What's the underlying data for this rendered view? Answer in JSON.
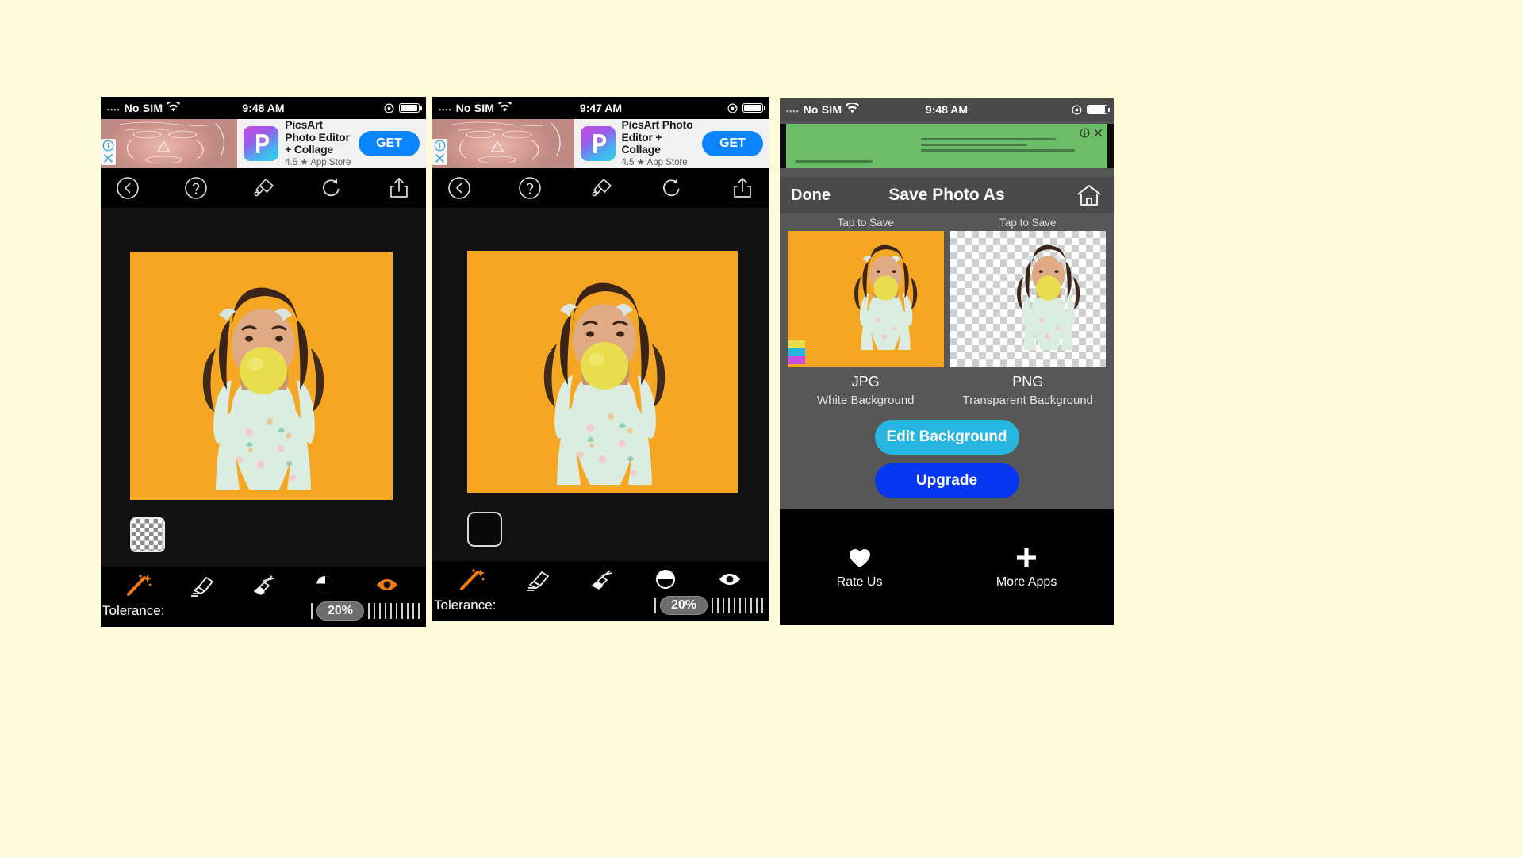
{
  "page": {
    "background_color": "#fdfbda"
  },
  "phones": [
    {
      "id": "phone-left",
      "status": {
        "dots": "••••",
        "carrier": "No SIM",
        "wifi_icon": "wifi-icon",
        "time": "9:48 AM",
        "lock_icon": "rotation-lock-icon",
        "battery_icon": "battery-icon"
      },
      "ad": {
        "info_icon": "ad-info-icon",
        "close_icon": "ad-close-icon",
        "app_icon": "picsart-app-icon",
        "title": "PicsArt Photo Editor + Collage",
        "subtitle": "4.5 ★ App Store",
        "cta": "GET"
      },
      "toolbar": [
        {
          "name": "back-button",
          "icon": "chevron-left-circle-icon"
        },
        {
          "name": "help-button",
          "icon": "question-circle-icon"
        },
        {
          "name": "brush-button",
          "icon": "paint-brush-icon"
        },
        {
          "name": "undo-button",
          "icon": "undo-arrow-icon"
        },
        {
          "name": "share-button",
          "icon": "share-upload-icon"
        }
      ],
      "swatch": {
        "name": "transparent-background-swatch",
        "type": "checkerboard"
      },
      "tools": [
        {
          "name": "magic-wand-tool",
          "icon": "magic-wand-icon",
          "active": true
        },
        {
          "name": "eraser-tool",
          "icon": "eraser-icon",
          "active": false
        },
        {
          "name": "restore-tool",
          "icon": "restore-brush-icon",
          "active": false
        },
        {
          "name": "contrast-tool",
          "icon": "contrast-circle-icon",
          "active": false
        },
        {
          "name": "preview-tool",
          "icon": "eye-icon",
          "active": true
        }
      ],
      "tolerance": {
        "label": "Tolerance:",
        "value": "20%"
      }
    },
    {
      "id": "phone-middle",
      "status": {
        "dots": "••••",
        "carrier": "No SIM",
        "wifi_icon": "wifi-icon",
        "time": "9:47 AM",
        "lock_icon": "rotation-lock-icon",
        "battery_icon": "battery-icon"
      },
      "ad": {
        "info_icon": "ad-info-icon",
        "close_icon": "ad-close-icon",
        "app_icon": "picsart-app-icon",
        "title": "PicsArt Photo Editor + Collage",
        "subtitle": "4.5 ★ App Store",
        "cta": "GET"
      },
      "toolbar": [
        {
          "name": "back-button",
          "icon": "chevron-left-circle-icon"
        },
        {
          "name": "help-button",
          "icon": "question-circle-icon"
        },
        {
          "name": "brush-button",
          "icon": "paint-brush-icon"
        },
        {
          "name": "undo-button",
          "icon": "undo-arrow-icon"
        },
        {
          "name": "share-button",
          "icon": "share-upload-icon"
        }
      ],
      "swatch": {
        "name": "black-background-swatch",
        "type": "solid",
        "color": "#0a0a0a"
      },
      "tools": [
        {
          "name": "magic-wand-tool",
          "icon": "magic-wand-icon",
          "active": true
        },
        {
          "name": "eraser-tool",
          "icon": "eraser-icon",
          "active": false
        },
        {
          "name": "restore-tool",
          "icon": "restore-brush-icon",
          "active": false
        },
        {
          "name": "contrast-tool",
          "icon": "contrast-circle-icon",
          "active": false
        },
        {
          "name": "preview-tool",
          "icon": "eye-icon",
          "active": false
        }
      ],
      "tolerance": {
        "label": "Tolerance:",
        "value": "20%"
      }
    }
  ],
  "save_screen": {
    "status": {
      "dots": "••••",
      "carrier": "No SIM",
      "wifi_icon": "wifi-icon",
      "time": "9:48 AM",
      "lock_icon": "rotation-lock-icon",
      "battery_icon": "battery-icon"
    },
    "ad": {
      "background_color": "#6cbd67",
      "info_icon": "ad-info-icon",
      "close_icon": "ad-close-icon"
    },
    "nav": {
      "done": "Done",
      "title": "Save Photo As",
      "home_icon": "home-icon"
    },
    "options": [
      {
        "tap_label": "Tap to Save",
        "format": "JPG",
        "description": "White Background",
        "thumb": "jpg-orange-thumbnail"
      },
      {
        "tap_label": "Tap to Save",
        "format": "PNG",
        "description": "Transparent Background",
        "thumb": "png-transparent-thumbnail"
      }
    ],
    "buttons": [
      {
        "name": "edit-background-button",
        "label": "Edit Background",
        "color": "#27b6e0"
      },
      {
        "name": "upgrade-button",
        "label": "Upgrade",
        "color": "#0536f0"
      }
    ],
    "footer": [
      {
        "name": "rate-us-button",
        "label": "Rate Us",
        "icon": "heart-icon"
      },
      {
        "name": "more-apps-button",
        "label": "More Apps",
        "icon": "plus-icon"
      }
    ]
  }
}
